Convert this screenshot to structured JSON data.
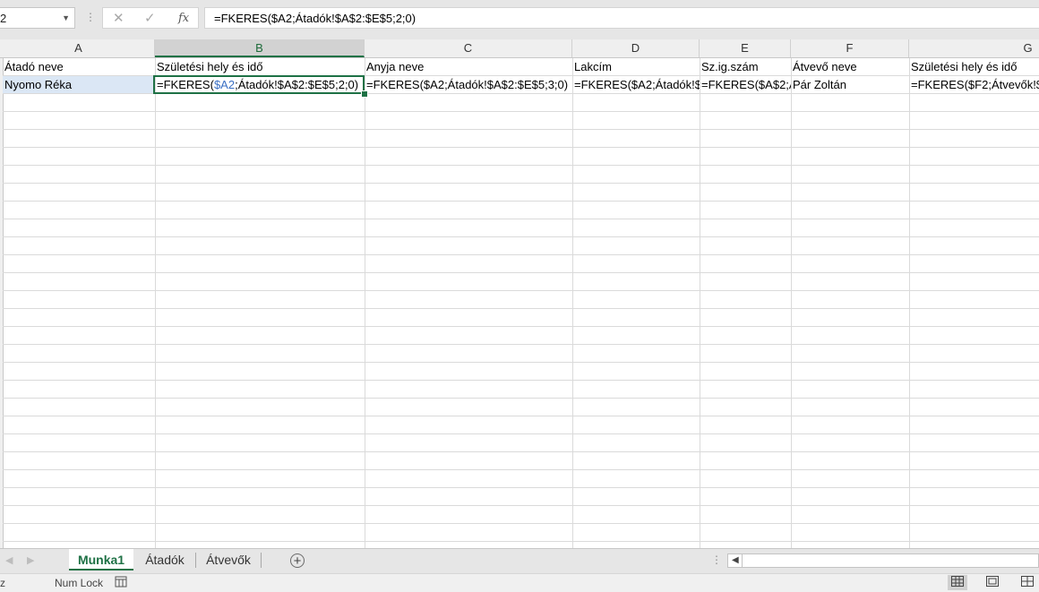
{
  "formula_bar": {
    "name_box": "2",
    "cancel_glyph": "✕",
    "enter_glyph": "✓",
    "fx_glyph": "fx",
    "formula": "=FKERES($A2;Átadók!$A$2:$E$5;2;0)"
  },
  "columns": [
    "A",
    "B",
    "C",
    "D",
    "E",
    "F",
    "G"
  ],
  "rows": {
    "row1": {
      "a": "Átadó neve",
      "b": "Születési hely és idő",
      "c": "Anyja neve",
      "d": "Lakcím",
      "e": "Sz.ig.szám",
      "f": "Átvevő neve",
      "g": "Születési hely és idő"
    },
    "row2": {
      "a": "Nyomo Réka",
      "b_prefix": "=FKERES(",
      "b_ref": "$A2",
      "b_suffix": ";Átadók!$A$2:$E$5;2;0)",
      "c": "=FKERES($A2;Átadók!$A$2:$E$5;3;0)",
      "d": "=FKERES($A2;Átadók!$",
      "e": "=FKERES($A$2;Á",
      "f": "Pár Zoltán",
      "g": "=FKERES($F2;Átvevők!$"
    }
  },
  "sheet_tabs": [
    "Munka1",
    "Átadók",
    "Átvevők"
  ],
  "active_tab": "Munka1",
  "status_bar": {
    "mode": "z",
    "num_lock": "Num Lock"
  },
  "colors": {
    "accent": "#1e7145",
    "reference": "#3a6fc4",
    "selected_row_fill": "#dbe7f5"
  },
  "icons": [
    "cancel-icon",
    "enter-icon",
    "function-icon",
    "add-sheet-icon",
    "macro-record-icon",
    "normal-view-icon",
    "page-layout-icon",
    "page-break-icon"
  ]
}
